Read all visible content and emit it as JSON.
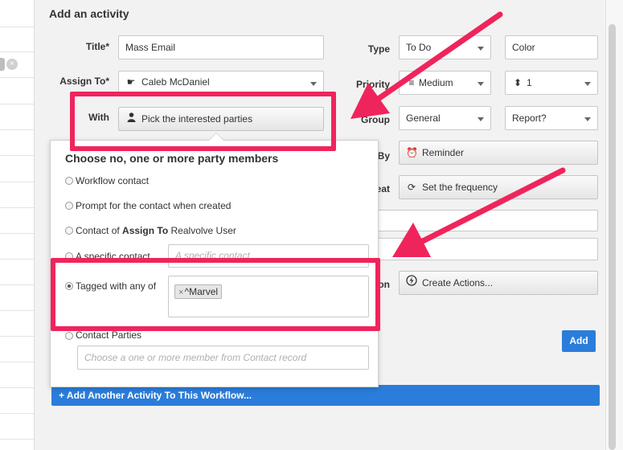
{
  "panel": {
    "heading": "Add an activity"
  },
  "labels": {
    "title": "Title*",
    "assign_to": "Assign To*",
    "with": "With",
    "type": "Type",
    "priority": "Priority",
    "group": "Group",
    "by": "By",
    "repeat": "eat",
    "action": "on"
  },
  "fields": {
    "title_value": "Mass Email",
    "assign_to_value": "Caleb McDaniel",
    "with_value": "Pick the interested parties",
    "type_value": "To Do",
    "color_value": "Color",
    "priority_value": "Medium",
    "priority_order_value": "1",
    "group_value": "General",
    "report_value": "Report?",
    "reminder_label": "Reminder",
    "frequency_label": "Set the frequency",
    "create_actions_label": "Create Actions..."
  },
  "popover": {
    "title": "Choose no, one or more party members",
    "options": {
      "workflow_contact": "Workflow contact",
      "prompt_contact": "Prompt for the contact when created",
      "contact_of_prefix": "Contact of",
      "contact_of_bold": "Assign To",
      "contact_of_suffix": "Realvolve User",
      "specific_contact": "A specific contact",
      "tagged_with": "Tagged with any of",
      "contact_parties": "Contact Parties"
    },
    "specific_contact_placeholder": "A specific contact",
    "tag_value": "^Marvel",
    "tag_remove": "×",
    "contact_parties_placeholder": "Choose a one or more member from Contact record",
    "selected_option": "tagged_with"
  },
  "buttons": {
    "add": "Add",
    "add_another": "+ Add Another Activity To This Workflow..."
  },
  "left_list": {
    "remove_icon": "×"
  },
  "colors": {
    "highlight": "#f0245c",
    "accent": "#2b7ddb"
  },
  "icons": {
    "assign": "pointing-hand-icon",
    "with": "person-icon",
    "priority": "priority-bars-icon",
    "priority_order": "sort-icon",
    "reminder": "alarm-clock-icon",
    "frequency": "refresh-icon",
    "create_actions": "lightning-icon"
  }
}
